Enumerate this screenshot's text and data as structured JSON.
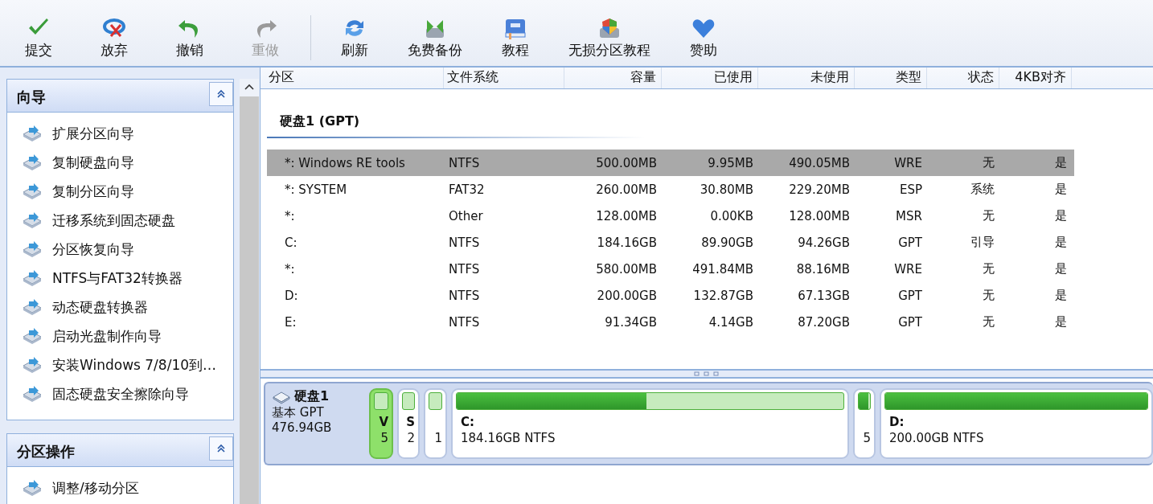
{
  "toolbar": [
    {
      "label": "提交",
      "disabled": false
    },
    {
      "label": "放弃",
      "disabled": false
    },
    {
      "label": "撤销",
      "disabled": false
    },
    {
      "label": "重做",
      "disabled": true
    },
    {
      "label": "刷新",
      "disabled": false
    },
    {
      "label": "免费备份",
      "disabled": false
    },
    {
      "label": "教程",
      "disabled": false
    },
    {
      "label": "无损分区教程",
      "disabled": false
    },
    {
      "label": "赞助",
      "disabled": false
    }
  ],
  "sidebar": {
    "sections": [
      {
        "title": "向导",
        "expanded": true,
        "items": [
          "扩展分区向导",
          "复制硬盘向导",
          "复制分区向导",
          "迁移系统到固态硬盘",
          "分区恢复向导",
          "NTFS与FAT32转换器",
          "动态硬盘转换器",
          "启动光盘制作向导",
          "安装Windows 7/8/10到…",
          "固态硬盘安全擦除向导"
        ]
      },
      {
        "title": "分区操作",
        "expanded": true,
        "items": [
          "调整/移动分区"
        ]
      }
    ]
  },
  "table": {
    "columns": [
      "分区",
      "文件系统",
      "容量",
      "已使用",
      "未使用",
      "类型",
      "状态",
      "4KB对齐"
    ],
    "disk_heading": "硬盘1 (GPT)",
    "rows": [
      {
        "selected": true,
        "cells": [
          "*: Windows RE tools",
          "NTFS",
          "500.00MB",
          "9.95MB",
          "490.05MB",
          "WRE",
          "无",
          "是"
        ]
      },
      {
        "selected": false,
        "cells": [
          "*: SYSTEM",
          "FAT32",
          "260.00MB",
          "30.80MB",
          "229.20MB",
          "ESP",
          "系统",
          "是"
        ]
      },
      {
        "selected": false,
        "cells": [
          "*:",
          "Other",
          "128.00MB",
          "0.00KB",
          "128.00MB",
          "MSR",
          "无",
          "是"
        ]
      },
      {
        "selected": false,
        "cells": [
          "C:",
          "NTFS",
          "184.16GB",
          "89.90GB",
          "94.26GB",
          "GPT",
          "引导",
          "是"
        ]
      },
      {
        "selected": false,
        "cells": [
          "*:",
          "NTFS",
          "580.00MB",
          "491.84MB",
          "88.16MB",
          "WRE",
          "无",
          "是"
        ]
      },
      {
        "selected": false,
        "cells": [
          "D:",
          "NTFS",
          "200.00GB",
          "132.87GB",
          "67.13GB",
          "GPT",
          "无",
          "是"
        ]
      },
      {
        "selected": false,
        "cells": [
          "E:",
          "NTFS",
          "91.34GB",
          "4.14GB",
          "87.20GB",
          "GPT",
          "无",
          "是"
        ]
      }
    ]
  },
  "disk_map": {
    "disk": {
      "name": "硬盘1",
      "type": "基本 GPT",
      "size": "476.94GB"
    },
    "partitions": [
      {
        "label": "V",
        "number": "5",
        "selected": true
      },
      {
        "label": "S",
        "number": "2",
        "selected": false
      },
      {
        "number": "1",
        "selected": false
      },
      {
        "label": "C:",
        "info": "184.16GB NTFS",
        "level": 0.49,
        "selected": false
      },
      {
        "number": "5",
        "level": 0.85,
        "selected": false
      },
      {
        "label": "D:",
        "info": "200.00GB NTFS",
        "level": 1.0,
        "selected": false
      }
    ]
  }
}
